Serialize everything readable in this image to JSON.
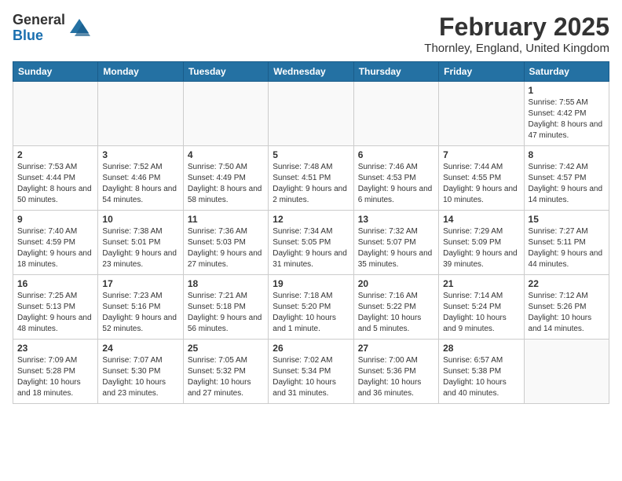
{
  "logo": {
    "general": "General",
    "blue": "Blue"
  },
  "title": {
    "month_year": "February 2025",
    "location": "Thornley, England, United Kingdom"
  },
  "headers": [
    "Sunday",
    "Monday",
    "Tuesday",
    "Wednesday",
    "Thursday",
    "Friday",
    "Saturday"
  ],
  "weeks": [
    [
      {
        "day": "",
        "info": ""
      },
      {
        "day": "",
        "info": ""
      },
      {
        "day": "",
        "info": ""
      },
      {
        "day": "",
        "info": ""
      },
      {
        "day": "",
        "info": ""
      },
      {
        "day": "",
        "info": ""
      },
      {
        "day": "1",
        "info": "Sunrise: 7:55 AM\nSunset: 4:42 PM\nDaylight: 8 hours and 47 minutes."
      }
    ],
    [
      {
        "day": "2",
        "info": "Sunrise: 7:53 AM\nSunset: 4:44 PM\nDaylight: 8 hours and 50 minutes."
      },
      {
        "day": "3",
        "info": "Sunrise: 7:52 AM\nSunset: 4:46 PM\nDaylight: 8 hours and 54 minutes."
      },
      {
        "day": "4",
        "info": "Sunrise: 7:50 AM\nSunset: 4:49 PM\nDaylight: 8 hours and 58 minutes."
      },
      {
        "day": "5",
        "info": "Sunrise: 7:48 AM\nSunset: 4:51 PM\nDaylight: 9 hours and 2 minutes."
      },
      {
        "day": "6",
        "info": "Sunrise: 7:46 AM\nSunset: 4:53 PM\nDaylight: 9 hours and 6 minutes."
      },
      {
        "day": "7",
        "info": "Sunrise: 7:44 AM\nSunset: 4:55 PM\nDaylight: 9 hours and 10 minutes."
      },
      {
        "day": "8",
        "info": "Sunrise: 7:42 AM\nSunset: 4:57 PM\nDaylight: 9 hours and 14 minutes."
      }
    ],
    [
      {
        "day": "9",
        "info": "Sunrise: 7:40 AM\nSunset: 4:59 PM\nDaylight: 9 hours and 18 minutes."
      },
      {
        "day": "10",
        "info": "Sunrise: 7:38 AM\nSunset: 5:01 PM\nDaylight: 9 hours and 23 minutes."
      },
      {
        "day": "11",
        "info": "Sunrise: 7:36 AM\nSunset: 5:03 PM\nDaylight: 9 hours and 27 minutes."
      },
      {
        "day": "12",
        "info": "Sunrise: 7:34 AM\nSunset: 5:05 PM\nDaylight: 9 hours and 31 minutes."
      },
      {
        "day": "13",
        "info": "Sunrise: 7:32 AM\nSunset: 5:07 PM\nDaylight: 9 hours and 35 minutes."
      },
      {
        "day": "14",
        "info": "Sunrise: 7:29 AM\nSunset: 5:09 PM\nDaylight: 9 hours and 39 minutes."
      },
      {
        "day": "15",
        "info": "Sunrise: 7:27 AM\nSunset: 5:11 PM\nDaylight: 9 hours and 44 minutes."
      }
    ],
    [
      {
        "day": "16",
        "info": "Sunrise: 7:25 AM\nSunset: 5:13 PM\nDaylight: 9 hours and 48 minutes."
      },
      {
        "day": "17",
        "info": "Sunrise: 7:23 AM\nSunset: 5:16 PM\nDaylight: 9 hours and 52 minutes."
      },
      {
        "day": "18",
        "info": "Sunrise: 7:21 AM\nSunset: 5:18 PM\nDaylight: 9 hours and 56 minutes."
      },
      {
        "day": "19",
        "info": "Sunrise: 7:18 AM\nSunset: 5:20 PM\nDaylight: 10 hours and 1 minute."
      },
      {
        "day": "20",
        "info": "Sunrise: 7:16 AM\nSunset: 5:22 PM\nDaylight: 10 hours and 5 minutes."
      },
      {
        "day": "21",
        "info": "Sunrise: 7:14 AM\nSunset: 5:24 PM\nDaylight: 10 hours and 9 minutes."
      },
      {
        "day": "22",
        "info": "Sunrise: 7:12 AM\nSunset: 5:26 PM\nDaylight: 10 hours and 14 minutes."
      }
    ],
    [
      {
        "day": "23",
        "info": "Sunrise: 7:09 AM\nSunset: 5:28 PM\nDaylight: 10 hours and 18 minutes."
      },
      {
        "day": "24",
        "info": "Sunrise: 7:07 AM\nSunset: 5:30 PM\nDaylight: 10 hours and 23 minutes."
      },
      {
        "day": "25",
        "info": "Sunrise: 7:05 AM\nSunset: 5:32 PM\nDaylight: 10 hours and 27 minutes."
      },
      {
        "day": "26",
        "info": "Sunrise: 7:02 AM\nSunset: 5:34 PM\nDaylight: 10 hours and 31 minutes."
      },
      {
        "day": "27",
        "info": "Sunrise: 7:00 AM\nSunset: 5:36 PM\nDaylight: 10 hours and 36 minutes."
      },
      {
        "day": "28",
        "info": "Sunrise: 6:57 AM\nSunset: 5:38 PM\nDaylight: 10 hours and 40 minutes."
      },
      {
        "day": "",
        "info": ""
      }
    ]
  ]
}
